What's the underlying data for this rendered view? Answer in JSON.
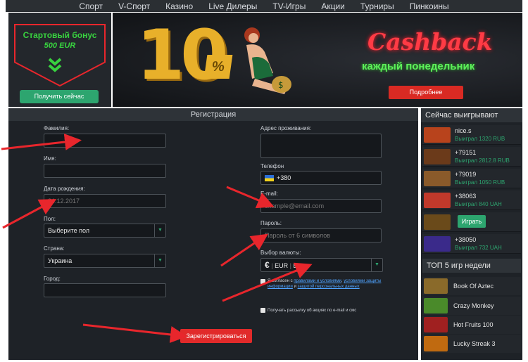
{
  "nav": [
    "Спорт",
    "V-Спорт",
    "Казино",
    "Live Дилеры",
    "TV-Игры",
    "Акции",
    "Турниры",
    "Пинкоины"
  ],
  "bonus": {
    "title": "Стартовый бонус",
    "amount": "500 EUR",
    "button": "Получить сейчас"
  },
  "banner": {
    "big": "10",
    "percent": "%",
    "cashback": "Cashback",
    "subtitle": "каждый понедельник",
    "button": "Подробнее"
  },
  "form": {
    "title": "Регистрация",
    "surname_label": "Фамилия:",
    "name_label": "Имя:",
    "birth_label": "Дата рождения:",
    "birth_placeholder": "24.12.2017",
    "gender_label": "Пол:",
    "gender_value": "Выберите пол",
    "country_label": "Страна:",
    "country_value": "Украина",
    "city_label": "Город:",
    "address_label": "Адрес проживания:",
    "phone_label": "Телефон",
    "phone_value": "+380",
    "email_label": "E-mail:",
    "email_placeholder": "example@email.com",
    "password_label": "Пароль:",
    "password_placeholder": "Пароль от 6 символов",
    "currency_label": "Выбор валюты:",
    "currency_symbol": "€",
    "currency_code": "EUR",
    "currency_name": "Евро",
    "agree_prefix": "Я согласен с",
    "agree_link1": "правилами и условиями",
    "agree_comma": ",",
    "agree_link2": "условиями защиты информации",
    "agree_and": "и",
    "agree_link3": "защитой персональных данных",
    "newsletter": "Получать рассылку об акциях по e-mail и смс",
    "register_button": "Зарегистрироваться"
  },
  "winners": {
    "title": "Сейчас выигрывают",
    "items": [
      {
        "name": "nice.s",
        "amount": "Выиграл 1320 RUB",
        "color": "#b8431c"
      },
      {
        "name": "+79151",
        "amount": "Выиграл 2812.8 RUB",
        "color": "#6b3a1a"
      },
      {
        "name": "+79019",
        "amount": "Выиграл 1050 RUB",
        "color": "#8a5a2a"
      },
      {
        "name": "+38063",
        "amount": "Выиграл 840 UAH",
        "color": "#c0392b"
      },
      {
        "name": "",
        "amount": "",
        "color": "#6a4a1a"
      },
      {
        "name": "+38050",
        "amount": "Выиграл 732 UAH",
        "color": "#3a2a8a"
      }
    ],
    "play_button": "Играть"
  },
  "top5": {
    "title": "ТОП 5 игр недели",
    "games": [
      {
        "name": "Book Of Aztec",
        "color": "#8a6a2a"
      },
      {
        "name": "Crazy Monkey",
        "color": "#4a8a2a"
      },
      {
        "name": "Hot Fruits 100",
        "color": "#a02020"
      },
      {
        "name": "Lucky Streak 3",
        "color": "#c06a10"
      }
    ]
  }
}
